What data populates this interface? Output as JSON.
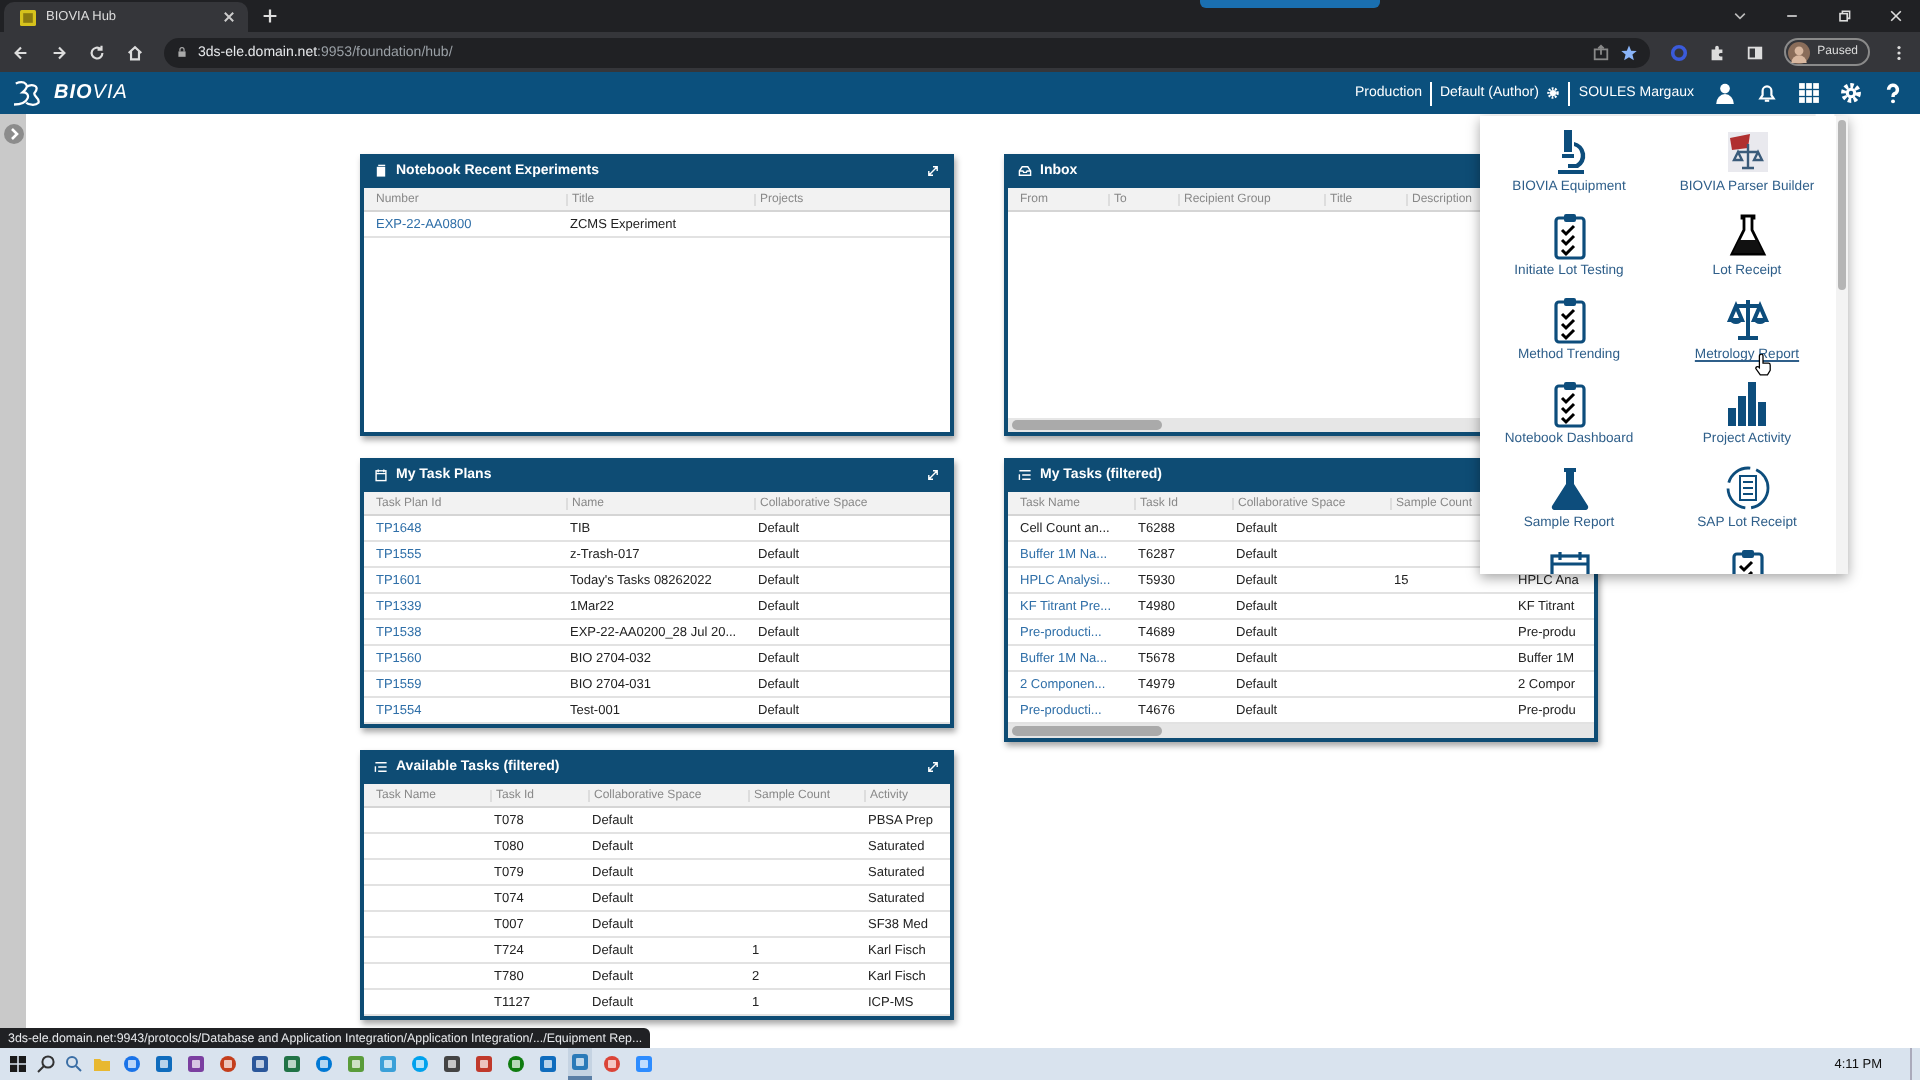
{
  "browser": {
    "tab_title": "BIOVIA Hub",
    "url": "**3ds-ele.domain.net**:9953/foundation/hub/",
    "profile": "Paused"
  },
  "header": {
    "brand": "**BIO**VIA",
    "environment": "Production",
    "role": "Default (Author)",
    "user": "SOULES Margaux"
  },
  "panel_columns": [
    [
      {
        "kind": "experiments",
        "title": "Notebook Recent Experiments",
        "columns": [
          "Number",
          "Title",
          "Projects"
        ],
        "rows": [
          {
            "link": true,
            "cells": [
              "EXP-22-AA0800",
              "ZCMS Experiment",
              null
            ]
          }
        ]
      },
      {
        "kind": "plans",
        "title": "My Task Plans",
        "columns": [
          "Task Plan Id",
          "Name",
          "Collaborative Space"
        ],
        "rows": [
          {
            "link": true,
            "cells": [
              "TP1648",
              "TIB",
              "Default"
            ]
          },
          {
            "link": true,
            "cells": [
              "TP1555",
              "z-Trash-017",
              "Default"
            ]
          },
          {
            "link": true,
            "cells": [
              "TP1601",
              "Today's Tasks 08262022",
              "Default"
            ]
          },
          {
            "link": true,
            "cells": [
              "TP1339",
              "1Mar22",
              "Default"
            ]
          },
          {
            "link": true,
            "cells": [
              "TP1538",
              "EXP-22-AA0200_28 Jul 20...",
              "Default"
            ]
          },
          {
            "link": true,
            "cells": [
              "TP1560",
              "BIO 2704-032",
              "Default"
            ]
          },
          {
            "link": true,
            "cells": [
              "TP1559",
              "BIO 2704-031",
              "Default"
            ]
          },
          {
            "link": true,
            "cells": [
              "TP1554",
              "Test-001",
              "Default"
            ]
          }
        ]
      },
      {
        "kind": "available",
        "title": "Available Tasks (filtered)",
        "columns": [
          "Task Name",
          "Task Id",
          "Collaborative Space",
          "Sample Count",
          "Activity"
        ],
        "rows": [
          {
            "cells": [
              null,
              "T078",
              "Default",
              null,
              "PBSA Prep"
            ]
          },
          {
            "cells": [
              null,
              "T080",
              "Default",
              null,
              "Saturated"
            ]
          },
          {
            "cells": [
              null,
              "T079",
              "Default",
              null,
              "Saturated"
            ]
          },
          {
            "cells": [
              null,
              "T074",
              "Default",
              null,
              "Saturated"
            ]
          },
          {
            "cells": [
              null,
              "T007",
              "Default",
              null,
              "SF38 Med"
            ]
          },
          {
            "cells": [
              null,
              "T724",
              "Default",
              "1",
              "Karl Fisch"
            ]
          },
          {
            "cells": [
              null,
              "T780",
              "Default",
              "2",
              "Karl Fisch"
            ]
          },
          {
            "cells": [
              null,
              "T1127",
              "Default",
              "1",
              "ICP-MS"
            ]
          }
        ]
      }
    ],
    [
      {
        "kind": "inbox",
        "title": "Inbox",
        "columns": [
          "From",
          "To",
          "Recipient Group",
          "Title",
          "Description"
        ]
      },
      {
        "kind": "tasks",
        "title": "My Tasks (filtered)",
        "columns": [
          "Task Name",
          "Task Id",
          "Collaborative Space",
          "Sample Count"
        ],
        "rows": [
          {
            "link": false,
            "cells": [
              "Cell Count an...",
              "T6288",
              "Default",
              null,
              null
            ]
          },
          {
            "link": true,
            "cells": [
              "Buffer 1M Na...",
              "T6287",
              "Default",
              null,
              null
            ]
          },
          {
            "link": true,
            "cells": [
              "HPLC Analysi...",
              "T5930",
              "Default",
              "15",
              "HPLC Ana"
            ]
          },
          {
            "link": true,
            "cells": [
              "KF Titrant Pre...",
              "T4980",
              "Default",
              null,
              "KF Titrant"
            ]
          },
          {
            "link": true,
            "cells": [
              "Pre-producti...",
              "T4689",
              "Default",
              null,
              "Pre-produ"
            ]
          },
          {
            "link": true,
            "cells": [
              "Buffer 1M Na...",
              "T5678",
              "Default",
              null,
              "Buffer 1M"
            ]
          },
          {
            "link": true,
            "cells": [
              "2 Componen...",
              "T4979",
              "Default",
              null,
              "2 Compor"
            ]
          },
          {
            "link": true,
            "cells": [
              "Pre-producti...",
              "T4676",
              "Default",
              null,
              "Pre-produ"
            ]
          }
        ]
      }
    ]
  ],
  "launcher": [
    {
      "kind": "microscope",
      "label": "BIOVIA Equipment",
      "hovered": false
    },
    {
      "kind": "parser",
      "label": "BIOVIA Parser Builder",
      "hovered": false
    },
    {
      "kind": "clipboard",
      "label": "Initiate Lot Testing",
      "hovered": false
    },
    {
      "kind": "beaker",
      "label": "Lot Receipt",
      "hovered": false
    },
    {
      "kind": "clipboard",
      "label": "Method Trending",
      "hovered": false
    },
    {
      "kind": "scales",
      "label": "Metrology Report",
      "hovered": true
    },
    {
      "kind": "clipboard",
      "label": "Notebook Dashboard",
      "hovered": false
    },
    {
      "kind": "chart",
      "label": "Project Activity",
      "hovered": false
    },
    {
      "kind": "flask",
      "label": "Sample Report",
      "hovered": false
    },
    {
      "kind": "cycle",
      "label": "SAP Lot Receipt",
      "hovered": false
    },
    {
      "kind": "calendar"
    },
    {
      "kind": "clipboard"
    }
  ],
  "status_url": "3ds-ele.domain.net:9943/protocols/Database and Application Integration/Application Integration/.../Equipment Rep...",
  "clock": "4:11 PM"
}
